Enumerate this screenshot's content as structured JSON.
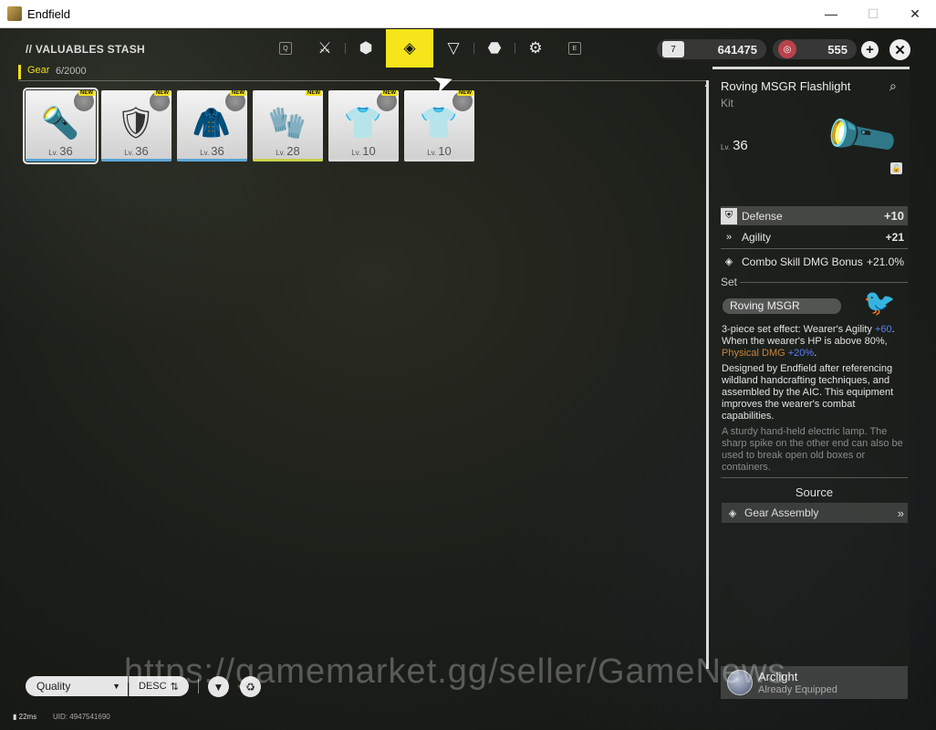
{
  "window": {
    "title": "Endfield",
    "minimize": "—",
    "maximize": "☐",
    "close": "✕"
  },
  "header": {
    "stash_title": "// VALUABLES STASH",
    "category": "Gear",
    "count": "6/2000",
    "key_left": "Q",
    "key_right": "E",
    "tabs": [
      {
        "icon": "weapon-icon",
        "glyph": "⚔"
      },
      {
        "icon": "box-icon",
        "glyph": "⬢"
      },
      {
        "icon": "gear-icon",
        "glyph": "◈"
      },
      {
        "icon": "triangle-icon",
        "glyph": "▽"
      },
      {
        "icon": "hexagon-icon",
        "glyph": "⬣"
      },
      {
        "icon": "ring-icon",
        "glyph": "⚙"
      }
    ],
    "active_tab": 2
  },
  "currency": {
    "primary": {
      "icon": "ticket-icon",
      "glyph": "7",
      "value": "641475"
    },
    "secondary": {
      "icon": "crystal-icon",
      "glyph": "◎",
      "value": "555"
    },
    "add": "+",
    "close": "✕"
  },
  "items": [
    {
      "name": "flashlight",
      "glyph": "🔦",
      "level_prefix": "Lv.",
      "level": "36",
      "badge": "NEW",
      "bar_color": "#5aa6d8"
    },
    {
      "name": "armor",
      "glyph": "🛡",
      "level_prefix": "Lv.",
      "level": "36",
      "badge": "NEW",
      "bar_color": "#5aa6d8"
    },
    {
      "name": "jacket",
      "glyph": "🧥",
      "level_prefix": "Lv.",
      "level": "36",
      "badge": "NEW",
      "bar_color": "#5aa6d8"
    },
    {
      "name": "gloves",
      "glyph": "🧤",
      "level_prefix": "Lv.",
      "level": "28",
      "badge": "NEW",
      "bar_color": "#c8d24a"
    },
    {
      "name": "vest",
      "glyph": "👕",
      "level_prefix": "Lv.",
      "level": "10",
      "badge": "NEW",
      "bar_color": "#d8d8d8"
    },
    {
      "name": "vest",
      "glyph": "👕",
      "level_prefix": "Lv.",
      "level": "10",
      "badge": "NEW",
      "bar_color": "#d8d8d8"
    }
  ],
  "detail": {
    "name": "Roving MSGR Flashlight",
    "type": "Kit",
    "level_prefix": "Lv.",
    "level": "36",
    "stats": [
      {
        "icon": "shield-icon",
        "glyph": "⛨",
        "label": "Defense",
        "value": "+10"
      },
      {
        "icon": "agility-icon",
        "glyph": "»",
        "label": "Agility",
        "value": "+21"
      },
      {
        "icon": "combo-icon",
        "glyph": "◈",
        "label": "Combo Skill DMG Bonus",
        "value": "+21.0%"
      }
    ],
    "set_label": "Set",
    "set_name": "Roving MSGR",
    "set_effect_a": "3-piece set effect: Wearer's Agility ",
    "set_effect_a_val": "+60",
    "set_effect_b": ". When the wearer's HP is above 80%, ",
    "set_effect_c": "Physical DMG",
    "set_effect_c_val": " +20%",
    "set_effect_d": ".",
    "description": "Designed by Endfield after referencing wildland handcrafting techniques, and assembled by the AIC. This equipment improves the wearer's combat capabilities.",
    "flavor": "A sturdy hand-held electric lamp. The sharp spike on the other end can also be used to break open old boxes or containers.",
    "source_title": "Source",
    "source": "Gear Assembly",
    "equipped_name": "Arclight",
    "equipped_status": "Already Equipped"
  },
  "footer": {
    "sort": "Quality",
    "order": "DESC",
    "ping": "22ms",
    "uid": "UID: 4947541690"
  },
  "watermark": "https://gamemarket.gg/seller/GameNews"
}
